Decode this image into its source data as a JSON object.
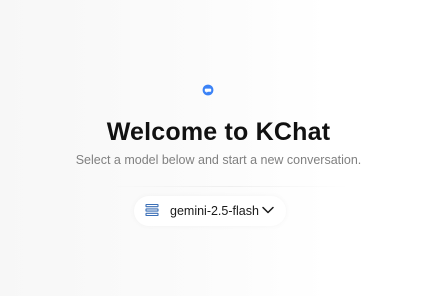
{
  "welcome": {
    "logo_icon": "chat-bubble-icon",
    "title": "Welcome to KChat",
    "subtitle": "Select a model below and start a new conversation."
  },
  "model_selector": {
    "icon": "model-list-icon",
    "selected_model": "gemini-2.5-flash",
    "dropdown_icon": "chevron-down-icon"
  },
  "colors": {
    "accent": "#3b82f6",
    "title": "#111111",
    "subtitle": "#808080"
  }
}
